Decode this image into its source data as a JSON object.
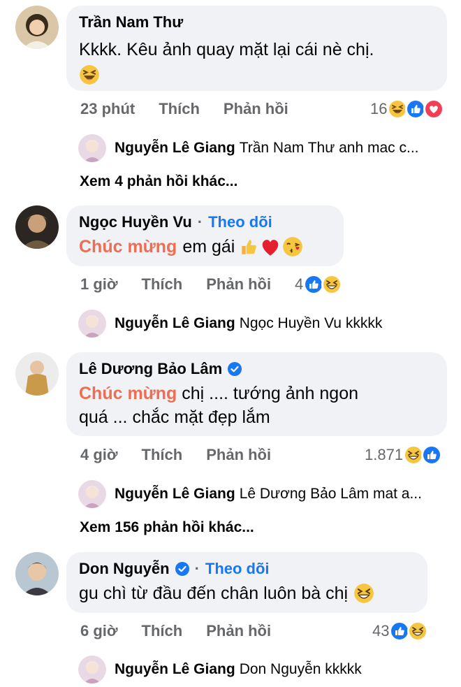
{
  "comments": [
    {
      "author": "Trần Nam Thư",
      "text": "Kkkk. Kêu ảnh quay mặt lại cái nè chị.",
      "time": "23 phút",
      "like": "Thích",
      "reply": "Phản hồi",
      "reaction_count": "16",
      "reply_preview": {
        "author": "Nguyễn Lê Giang",
        "text": "Trần Nam Thư anh mac c..."
      },
      "more_replies": "Xem 4 phản hồi khác..."
    },
    {
      "author": "Ngọc Huyền Vu",
      "follow": "Theo dõi",
      "highlight": "Chúc mừng",
      "text": "em gái",
      "time": "1 giờ",
      "like": "Thích",
      "reply": "Phản hồi",
      "reaction_count": "4",
      "reply_preview": {
        "author": "Nguyễn Lê Giang",
        "text": "Ngọc Huyền Vu kkkkk"
      }
    },
    {
      "author": "Lê Dương Bảo Lâm",
      "highlight": "Chúc mừng",
      "text_line1": "chị .... tướng ảnh ngon",
      "text_line2": "quá ... chắc mặt đẹp lắm",
      "time": "4 giờ",
      "like": "Thích",
      "reply": "Phản hồi",
      "reaction_count": "1.871",
      "reply_preview": {
        "author": "Nguyễn Lê Giang",
        "text": "Lê Dương Bảo Lâm mat a..."
      },
      "more_replies": "Xem 156 phản hồi khác..."
    },
    {
      "author": "Don Nguyễn",
      "follow": "Theo dõi",
      "text": "gu chì từ đầu đến chân luôn bà chị",
      "time": "6 giờ",
      "like": "Thích",
      "reply": "Phản hồi",
      "reaction_count": "43",
      "reply_preview": {
        "author": "Nguyễn Lê Giang",
        "text": "Don Nguyễn kkkkk"
      }
    }
  ],
  "colors": {
    "bubble": "#f0f2f5",
    "meta": "#65676b",
    "link": "#1877f2",
    "highlight": "#ec6f55"
  }
}
